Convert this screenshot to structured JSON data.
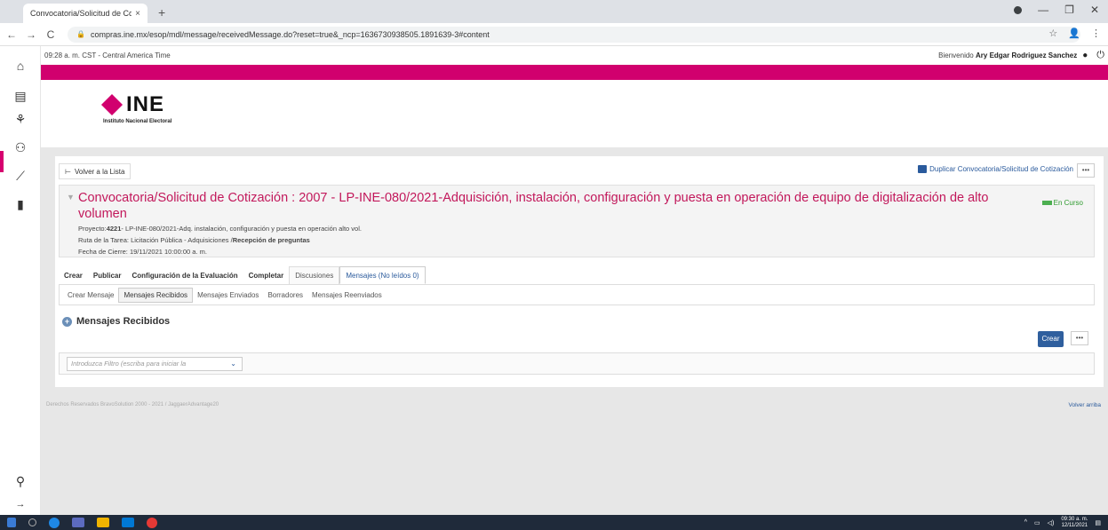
{
  "browser": {
    "tab_title": "Convocatoria/Solicitud de Cotiza",
    "tab_close": "×",
    "new_tab": "+",
    "url": "compras.ine.mx/esop/mdl/message/receivedMessage.do?reset=true&_ncp=1636730938505.1891639-3#content",
    "win_minimize": "—",
    "win_maximize": "❐",
    "win_close": "✕"
  },
  "header": {
    "time": "09:28 a. m. CST - Central America Time",
    "welcome_prefix": "Bienvenido",
    "user_name": "Ary Edgar Rodriguez Sanchez"
  },
  "logo": {
    "name": "INE",
    "subtitle": "Instituto Nacional Electoral"
  },
  "toolbar": {
    "back_label": "Volver a la Lista",
    "duplicate_label": "Duplicar Convocatoria/Solicitud de Cotización",
    "more_label": "•••"
  },
  "summary": {
    "title": "Convocatoria/Solicitud de Cotización : 2007 - LP-INE-080/2021-Adquisición, instalación, configuración y puesta en operación de equipo de digitalización de alto volumen",
    "project_label": "Proyecto:",
    "project_id": "4221",
    "project_text": "- LP-INE-080/2021-Adq. instalación, configuración y puesta en operación alto vol.",
    "route_label": "Ruta de la Tarea: Licitación Pública - Adquisiciones /",
    "route_current": "Recepción de preguntas",
    "close_date": "Fecha de Cierre: 19/11/2021 10:00:00 a. m.",
    "status": "En Curso"
  },
  "main_tabs": [
    "Crear",
    "Publicar",
    "Configuración de la Evaluación",
    "Completar",
    "Discusiones",
    "Mensajes (No leídos 0)"
  ],
  "sub_tabs": [
    "Crear Mensaje",
    "Mensajes Recibidos",
    "Mensajes Enviados",
    "Borradores",
    "Mensajes Reenviados"
  ],
  "section": {
    "title": "Mensajes Recibidos",
    "create_button": "Crear",
    "filter_placeholder": "Introduzca Filtro (escriba para iniciar la"
  },
  "footer": {
    "copyright": "Derechos Reservados BravoSolution 2000 - 2021 / JaggaerAdvantage20",
    "back_to_top": "Volver arriba"
  },
  "taskbar": {
    "clock_time": "09:30 a. m.",
    "clock_date": "12/11/2021"
  },
  "colors": {
    "brand_magenta": "#d1006e",
    "title_pink": "#c2185b",
    "link_blue": "#2a5a9c",
    "status_green": "#2e9b2e"
  }
}
